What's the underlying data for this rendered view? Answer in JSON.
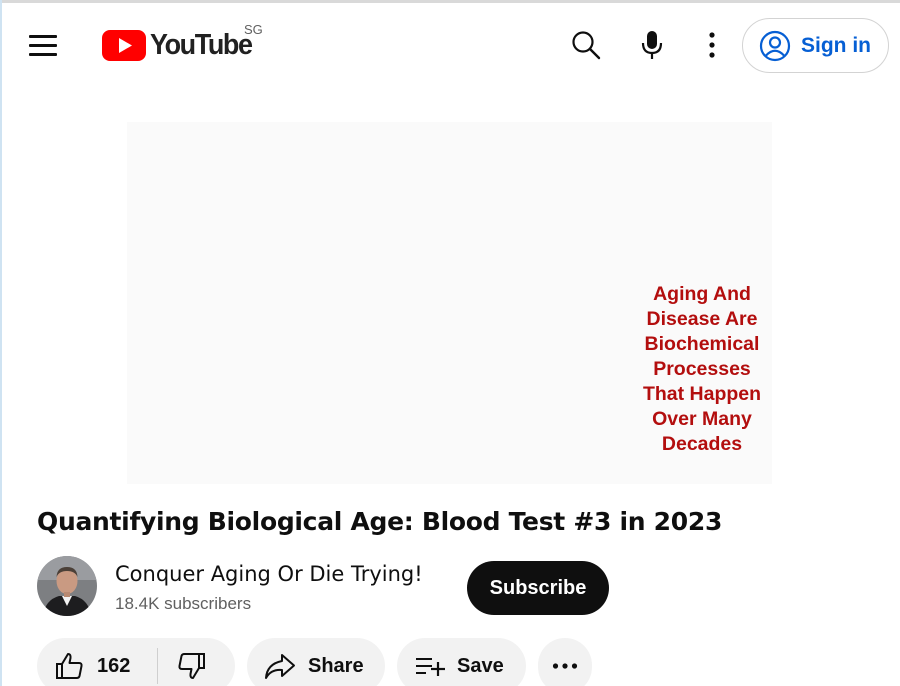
{
  "header": {
    "logo_text": "YouTube",
    "region": "SG",
    "signin_label": "Sign in",
    "icons": [
      "menu-icon",
      "search-icon",
      "microphone-icon",
      "more-vert-icon",
      "account-circle-icon"
    ]
  },
  "video": {
    "overlay_lines": [
      "Aging And",
      "Disease Are",
      "Biochemical",
      "Processes",
      "That Happen",
      "Over Many",
      "Decades"
    ]
  },
  "title": "Quantifying Biological Age: Blood Test #3 in 2023",
  "channel": {
    "name": "Conquer Aging Or Die Trying!",
    "subscribers": "18.4K subscribers",
    "subscribe_label": "Subscribe"
  },
  "actions": {
    "like_count": "162",
    "share_label": "Share",
    "save_label": "Save",
    "icons": [
      "thumbs-up-icon",
      "thumbs-down-icon",
      "share-icon",
      "playlist-add-icon",
      "more-horiz-icon"
    ]
  },
  "colors": {
    "brand_red": "#ff0000",
    "link_blue": "#065fd4",
    "caption_red": "#b30e0e",
    "pill_bg": "#f2f2f2"
  }
}
